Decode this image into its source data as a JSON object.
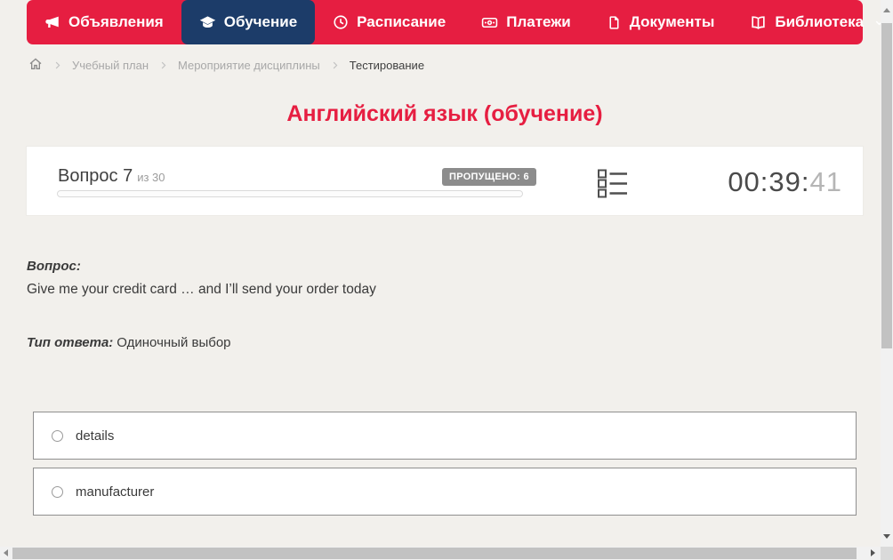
{
  "theme": {
    "accent_red": "#e61e41",
    "active_navy": "#1c3c69",
    "page_bg": "#f2f0ec",
    "badge_bg": "#8c8c8c"
  },
  "nav": {
    "items": [
      {
        "label": "Объявления",
        "icon": "megaphone-icon",
        "active": false
      },
      {
        "label": "Обучение",
        "icon": "graduation-cap-icon",
        "active": true
      },
      {
        "label": "Расписание",
        "icon": "clock-icon",
        "active": false
      },
      {
        "label": "Платежи",
        "icon": "banknote-icon",
        "active": false
      },
      {
        "label": "Документы",
        "icon": "document-icon",
        "active": false
      },
      {
        "label": "Библиотека",
        "icon": "book-icon",
        "active": false,
        "has_dropdown": true
      }
    ]
  },
  "breadcrumb": {
    "items": [
      "Учебный план",
      "Мероприятие дисциплины",
      "Тестирование"
    ]
  },
  "page_title": "Английский язык (обучение)",
  "question_header": {
    "question_label": "Вопрос 7",
    "question_of": "из 30",
    "skipped_badge": "ПРОПУЩЕНО: 6",
    "progress_percent": 0,
    "timer": {
      "main": "00:39:",
      "seconds": "41"
    }
  },
  "question": {
    "label": "Вопрос:",
    "text": "Give me your credit card … and I’ll send your order today",
    "type_label": "Тип ответа:",
    "type_value": "Одиночный выбор"
  },
  "answers": {
    "options": [
      {
        "label": "details",
        "selected": false
      },
      {
        "label": "manufacturer",
        "selected": false
      }
    ]
  }
}
